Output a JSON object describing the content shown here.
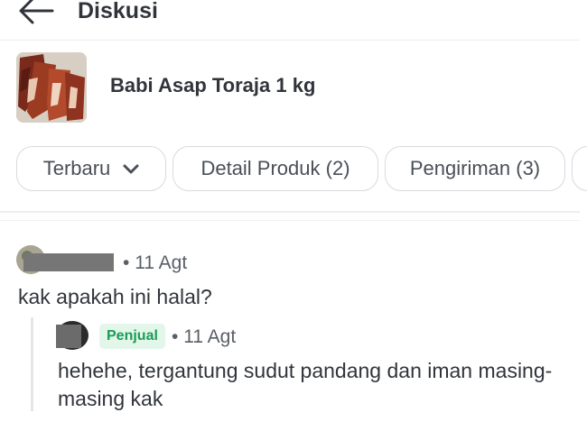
{
  "header": {
    "title": "Diskusi",
    "back_icon": "arrow-left-icon"
  },
  "product": {
    "name": "Babi Asap Toraja 1 kg"
  },
  "filters": {
    "sort_label": "Terbaru",
    "chips": [
      {
        "label": "Detail Produk (2)"
      },
      {
        "label": "Pengiriman (3)"
      }
    ]
  },
  "question": {
    "separator": "•",
    "date": "11 Agt",
    "text": "kak apakah ini halal?"
  },
  "reply": {
    "badge": "Penjual",
    "separator": "•",
    "date": "11 Agt",
    "text": "hehehe, tergantung sudut pandang dan iman masing-masing kak"
  },
  "colors": {
    "seller_badge_bg": "#e3f6ea",
    "seller_badge_text": "#1a9c55",
    "redaction": "#767676"
  }
}
